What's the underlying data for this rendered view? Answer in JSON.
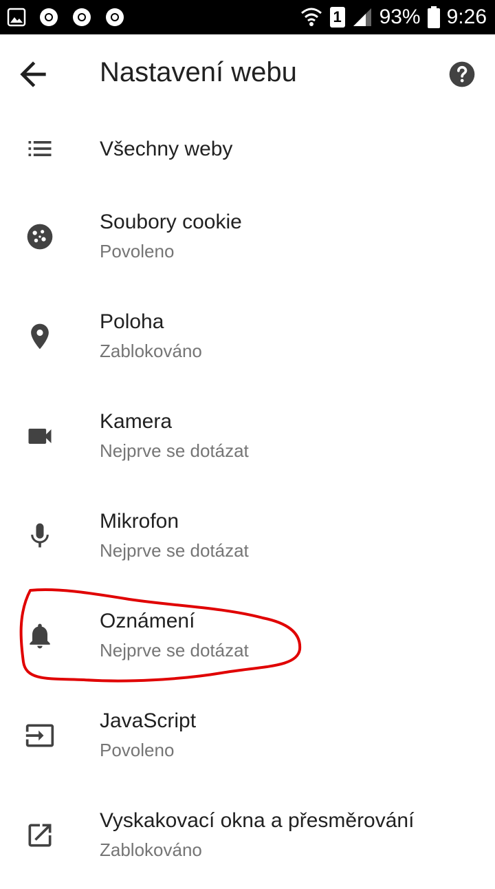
{
  "status_bar": {
    "battery_percent": "93%",
    "time": "9:26",
    "sim_slot": "1"
  },
  "app_bar": {
    "title": "Nastavení webu",
    "back_icon": "arrow-back-icon",
    "help_icon": "help-circle-icon"
  },
  "items": [
    {
      "label": "Všechny weby",
      "icon": "list-icon"
    },
    {
      "label": "Soubory cookie",
      "sub": "Povoleno",
      "icon": "cookie-icon"
    },
    {
      "label": "Poloha",
      "sub": "Zablokováno",
      "icon": "location-pin-icon"
    },
    {
      "label": "Kamera",
      "sub": "Nejprve se dotázat",
      "icon": "camera-icon"
    },
    {
      "label": "Mikrofon",
      "sub": "Nejprve se dotázat",
      "icon": "microphone-icon"
    },
    {
      "label": "Oznámení",
      "sub": "Nejprve se dotázat",
      "icon": "bell-icon"
    },
    {
      "label": "JavaScript",
      "sub": "Povoleno",
      "icon": "javascript-icon"
    },
    {
      "label": "Vyskakovací okna a přesměrování",
      "sub": "Zablokováno",
      "icon": "open-in-new-icon"
    }
  ],
  "colors": {
    "status_bar_bg": "#000000",
    "text_primary": "#212121",
    "text_secondary": "#757575",
    "icon": "#424242",
    "highlight_annotation": "#e00000"
  }
}
